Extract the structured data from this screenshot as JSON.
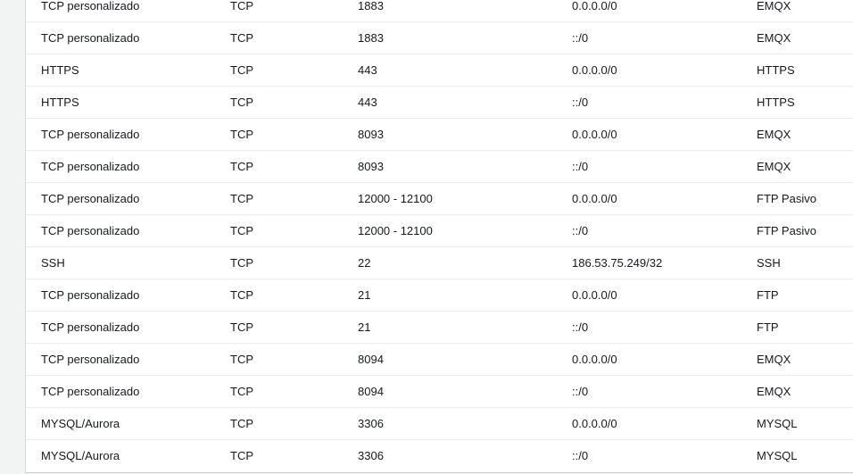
{
  "rules_table": {
    "rows": [
      {
        "type": "TCP personalizado",
        "protocol": "TCP",
        "port_range": "1883",
        "source": "0.0.0.0/0",
        "description": "EMQX"
      },
      {
        "type": "TCP personalizado",
        "protocol": "TCP",
        "port_range": "1883",
        "source": "::/0",
        "description": "EMQX"
      },
      {
        "type": "HTTPS",
        "protocol": "TCP",
        "port_range": "443",
        "source": "0.0.0.0/0",
        "description": "HTTPS"
      },
      {
        "type": "HTTPS",
        "protocol": "TCP",
        "port_range": "443",
        "source": "::/0",
        "description": "HTTPS"
      },
      {
        "type": "TCP personalizado",
        "protocol": "TCP",
        "port_range": "8093",
        "source": "0.0.0.0/0",
        "description": "EMQX"
      },
      {
        "type": "TCP personalizado",
        "protocol": "TCP",
        "port_range": "8093",
        "source": "::/0",
        "description": "EMQX"
      },
      {
        "type": "TCP personalizado",
        "protocol": "TCP",
        "port_range": "12000 - 12100",
        "source": "0.0.0.0/0",
        "description": "FTP Pasivo"
      },
      {
        "type": "TCP personalizado",
        "protocol": "TCP",
        "port_range": "12000 - 12100",
        "source": "::/0",
        "description": "FTP Pasivo"
      },
      {
        "type": "SSH",
        "protocol": "TCP",
        "port_range": "22",
        "source": "186.53.75.249/32",
        "description": "SSH"
      },
      {
        "type": "TCP personalizado",
        "protocol": "TCP",
        "port_range": "21",
        "source": "0.0.0.0/0",
        "description": "FTP"
      },
      {
        "type": "TCP personalizado",
        "protocol": "TCP",
        "port_range": "21",
        "source": "::/0",
        "description": "FTP"
      },
      {
        "type": "TCP personalizado",
        "protocol": "TCP",
        "port_range": "8094",
        "source": "0.0.0.0/0",
        "description": "EMQX"
      },
      {
        "type": "TCP personalizado",
        "protocol": "TCP",
        "port_range": "8094",
        "source": "::/0",
        "description": "EMQX"
      },
      {
        "type": "MYSQL/Aurora",
        "protocol": "TCP",
        "port_range": "3306",
        "source": "0.0.0.0/0",
        "description": "MYSQL"
      },
      {
        "type": "MYSQL/Aurora",
        "protocol": "TCP",
        "port_range": "3306",
        "source": "::/0",
        "description": "MYSQL"
      }
    ]
  }
}
